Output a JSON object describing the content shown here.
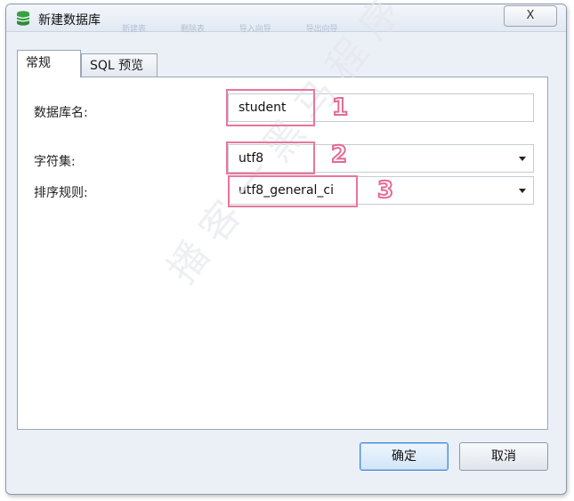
{
  "window": {
    "title": "新建数据库",
    "close_label": "X",
    "ghost_toolbar": [
      "新建表",
      "删除表",
      "导入向导",
      "导出向导"
    ]
  },
  "tabs": [
    {
      "label": "常规",
      "active": true
    },
    {
      "label": "SQL 预览",
      "active": false
    }
  ],
  "form": {
    "db_name": {
      "label": "数据库名:",
      "value": "student"
    },
    "charset": {
      "label": "字符集:",
      "value": "utf8"
    },
    "collation": {
      "label": "排序规则:",
      "value": "utf8_general_ci"
    }
  },
  "markers": [
    "1",
    "2",
    "3"
  ],
  "buttons": {
    "ok": "确定",
    "cancel": "取消"
  },
  "watermark": "播客一黑马程序员",
  "colors": {
    "highlight": "#e8769b",
    "accent": "#4a8bd6",
    "icon": "#3aa043"
  },
  "icons": {
    "title": "database-icon",
    "dropdown": "chevron-down-icon"
  }
}
